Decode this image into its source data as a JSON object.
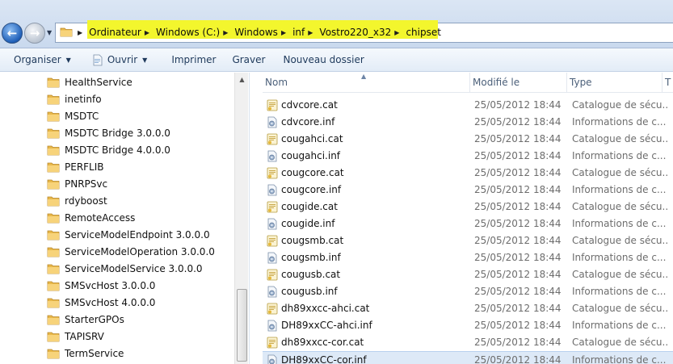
{
  "address_bar": {
    "breadcrumbs": [
      "Ordinateur",
      "Windows (C:)",
      "Windows",
      "inf",
      "Vostro220_x32",
      "chipset"
    ]
  },
  "toolbar": {
    "organize_label": "Organiser",
    "open_label": "Ouvrir",
    "print_label": "Imprimer",
    "burn_label": "Graver",
    "new_folder_label": "Nouveau dossier"
  },
  "nav_tree": {
    "items": [
      "HealthService",
      "inetinfo",
      "MSDTC",
      "MSDTC Bridge 3.0.0.0",
      "MSDTC Bridge 4.0.0.0",
      "PERFLIB",
      "PNRPSvc",
      "rdyboost",
      "RemoteAccess",
      "ServiceModelEndpoint 3.0.0.0",
      "ServiceModelOperation 3.0.0.0",
      "ServiceModelService 3.0.0.0",
      "SMSvcHost 3.0.0.0",
      "SMSvcHost 4.0.0.0",
      "StarterGPOs",
      "TAPISRV",
      "TermService"
    ]
  },
  "file_list": {
    "columns": {
      "name": "Nom",
      "modified": "Modifié le",
      "type": "Type",
      "extra": "T"
    },
    "rows": [
      {
        "name": "cdvcore.cat",
        "date": "25/05/2012 18:44",
        "type": "Catalogue de sécu...",
        "icon": "catalog-file-icon"
      },
      {
        "name": "cdvcore.inf",
        "date": "25/05/2012 18:44",
        "type": "Informations de c...",
        "icon": "setup-info-file-icon"
      },
      {
        "name": "cougahci.cat",
        "date": "25/05/2012 18:44",
        "type": "Catalogue de sécu...",
        "icon": "catalog-file-icon"
      },
      {
        "name": "cougahci.inf",
        "date": "25/05/2012 18:44",
        "type": "Informations de c...",
        "icon": "setup-info-file-icon"
      },
      {
        "name": "cougcore.cat",
        "date": "25/05/2012 18:44",
        "type": "Catalogue de sécu...",
        "icon": "catalog-file-icon"
      },
      {
        "name": "cougcore.inf",
        "date": "25/05/2012 18:44",
        "type": "Informations de c...",
        "icon": "setup-info-file-icon"
      },
      {
        "name": "cougide.cat",
        "date": "25/05/2012 18:44",
        "type": "Catalogue de sécu...",
        "icon": "catalog-file-icon"
      },
      {
        "name": "cougide.inf",
        "date": "25/05/2012 18:44",
        "type": "Informations de c...",
        "icon": "setup-info-file-icon"
      },
      {
        "name": "cougsmb.cat",
        "date": "25/05/2012 18:44",
        "type": "Catalogue de sécu...",
        "icon": "catalog-file-icon"
      },
      {
        "name": "cougsmb.inf",
        "date": "25/05/2012 18:44",
        "type": "Informations de c...",
        "icon": "setup-info-file-icon"
      },
      {
        "name": "cougusb.cat",
        "date": "25/05/2012 18:44",
        "type": "Catalogue de sécu...",
        "icon": "catalog-file-icon"
      },
      {
        "name": "cougusb.inf",
        "date": "25/05/2012 18:44",
        "type": "Informations de c...",
        "icon": "setup-info-file-icon"
      },
      {
        "name": "dh89xxcc-ahci.cat",
        "date": "25/05/2012 18:44",
        "type": "Catalogue de sécu...",
        "icon": "catalog-file-icon"
      },
      {
        "name": "DH89xxCC-ahci.inf",
        "date": "25/05/2012 18:44",
        "type": "Informations de c...",
        "icon": "setup-info-file-icon"
      },
      {
        "name": "dh89xxcc-cor.cat",
        "date": "25/05/2012 18:44",
        "type": "Catalogue de sécu...",
        "icon": "catalog-file-icon"
      },
      {
        "name": "DH89xxCC-cor.inf",
        "date": "25/05/2012 18:44",
        "type": "Informations de c...",
        "icon": "setup-info-file-icon",
        "selected": true
      }
    ]
  },
  "colors": {
    "address_highlight": "#f3f62d",
    "toolbar_text": "#1e395b",
    "selection": "#dde9f7",
    "folder": "#e8b84a"
  }
}
